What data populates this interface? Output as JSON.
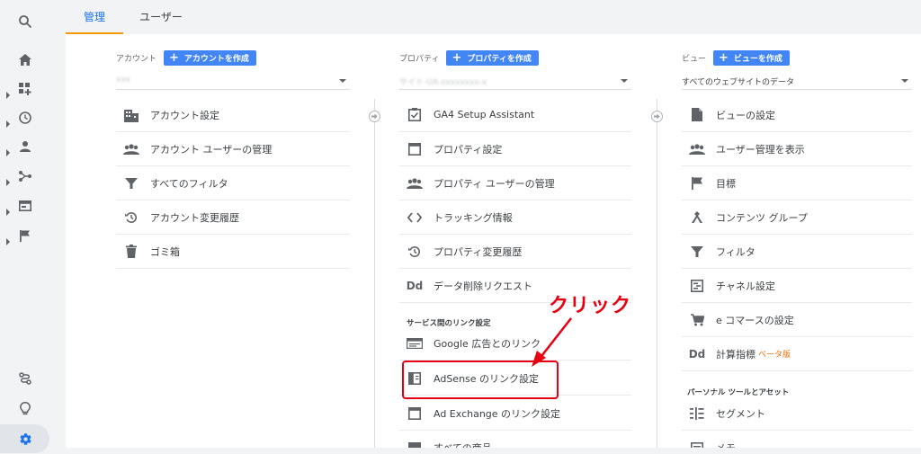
{
  "tabs": {
    "admin": "管理",
    "users": "ユーザー"
  },
  "account": {
    "label": "アカウント",
    "create_button": "アカウントを作成",
    "selected": "xxx",
    "items": [
      {
        "label": "アカウント設定",
        "icon": "building-icon"
      },
      {
        "label": "アカウント ユーザーの管理",
        "icon": "people-icon"
      },
      {
        "label": "すべてのフィルタ",
        "icon": "filter-icon"
      },
      {
        "label": "アカウント変更履歴",
        "icon": "history-icon"
      },
      {
        "label": "ゴミ箱",
        "icon": "trash-icon"
      }
    ]
  },
  "property": {
    "label": "プロパティ",
    "create_button": "プロパティを作成",
    "selected": "サイト-UA-xxxxxxxx-x",
    "items": [
      {
        "label": "GA4 Setup Assistant",
        "icon": "checkbox-icon"
      },
      {
        "label": "プロパティ設定",
        "icon": "window-icon"
      },
      {
        "label": "プロパティ ユーザーの管理",
        "icon": "people-icon"
      },
      {
        "label": "トラッキング情報",
        "icon": "code-icon"
      },
      {
        "label": "プロパティ変更履歴",
        "icon": "history-icon"
      },
      {
        "label": "データ削除リクエスト",
        "icon": "dd-icon"
      }
    ],
    "link_section": "サービス間のリンク設定",
    "link_items": [
      {
        "label": "Google 広告とのリンク",
        "icon": "google-ads-icon"
      },
      {
        "label": "AdSense のリンク設定",
        "icon": "adsense-icon"
      },
      {
        "label": "Ad Exchange のリンク設定",
        "icon": "window-icon"
      },
      {
        "label": "すべての商品",
        "icon": "products-icon"
      }
    ]
  },
  "view": {
    "label": "ビュー",
    "create_button": "ビューを作成",
    "selected": "すべてのウェブサイトのデータ",
    "items": [
      {
        "label": "ビューの設定",
        "icon": "document-icon"
      },
      {
        "label": "ユーザー管理を表示",
        "icon": "people-icon"
      },
      {
        "label": "目標",
        "icon": "flag-icon"
      },
      {
        "label": "コンテンツ グループ",
        "icon": "tool-icon"
      },
      {
        "label": "フィルタ",
        "icon": "filter-icon"
      },
      {
        "label": "チャネル設定",
        "icon": "channel-icon"
      },
      {
        "label": "e コマースの設定",
        "icon": "cart-icon"
      },
      {
        "label": "計算指標",
        "icon": "dd-icon",
        "badge": "ベータ版"
      }
    ],
    "tools_section": "パーソナル ツールとアセット",
    "tools_items": [
      {
        "label": "セグメント",
        "icon": "segment-icon"
      },
      {
        "label": "メモ",
        "icon": "note-icon"
      }
    ]
  },
  "annotation": {
    "text": "クリック",
    "color": "#e60012"
  },
  "colors": {
    "accent": "#1a73e8",
    "button": "#4285f4",
    "tab_underline": "#f29900"
  }
}
